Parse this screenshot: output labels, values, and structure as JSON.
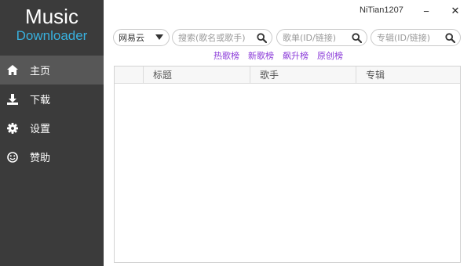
{
  "app": {
    "name": "Music",
    "subtitle": "Downloader",
    "username": "NiTian1207"
  },
  "window": {
    "minimize": "−",
    "close": "✕"
  },
  "sidebar": {
    "items": [
      {
        "label": "主页",
        "icon": "home-icon",
        "active": true
      },
      {
        "label": "下载",
        "icon": "download-icon",
        "active": false
      },
      {
        "label": "设置",
        "icon": "gear-icon",
        "active": false
      },
      {
        "label": "赞助",
        "icon": "smile-icon",
        "active": false
      }
    ]
  },
  "source_select": {
    "value": "网易云"
  },
  "search": {
    "song_placeholder": "搜索(歌名或歌手)",
    "playlist_placeholder": "歌单(ID/链接)",
    "album_placeholder": "专辑(ID/链接)"
  },
  "charts": [
    "热歌榜",
    "新歌榜",
    "飙升榜",
    "原创榜"
  ],
  "table": {
    "columns": [
      "",
      "标题",
      "歌手",
      "专辑"
    ],
    "rows": []
  },
  "colors": {
    "sidebar_bg": "#3b3b3b",
    "sidebar_active": "#575757",
    "accent_blue": "#38b0de",
    "link_purple": "#8a3ad8"
  }
}
